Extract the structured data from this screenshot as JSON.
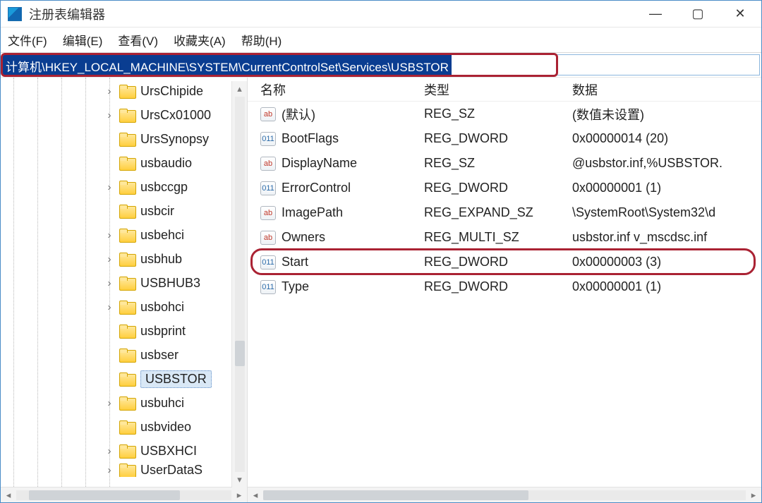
{
  "title": "注册表编辑器",
  "window_controls": {
    "min": "—",
    "max": "▢",
    "close": "✕"
  },
  "menu": {
    "file": "文件(F)",
    "edit": "编辑(E)",
    "view": "查看(V)",
    "favorites": "收藏夹(A)",
    "help": "帮助(H)"
  },
  "address_path": "计算机\\HKEY_LOCAL_MACHINE\\SYSTEM\\CurrentControlSet\\Services\\USBSTOR",
  "tree": {
    "items": [
      {
        "label": "UrsChipide",
        "expand": ">",
        "scroll_hint": "^"
      },
      {
        "label": "UrsCx01000",
        "expand": ">"
      },
      {
        "label": "UrsSynopsy"
      },
      {
        "label": "usbaudio"
      },
      {
        "label": "usbccgp",
        "expand": ">"
      },
      {
        "label": "usbcir"
      },
      {
        "label": "usbehci",
        "expand": ">"
      },
      {
        "label": "usbhub",
        "expand": ">"
      },
      {
        "label": "USBHUB3",
        "expand": ">"
      },
      {
        "label": "usbohci",
        "expand": ">"
      },
      {
        "label": "usbprint"
      },
      {
        "label": "usbser"
      },
      {
        "label": "USBSTOR",
        "selected": true
      },
      {
        "label": "usbuhci",
        "expand": ">"
      },
      {
        "label": "usbvideo"
      },
      {
        "label": "USBXHCI",
        "expand": ">"
      },
      {
        "label": "UserDataS",
        "expand": ">",
        "cutoff": true
      }
    ]
  },
  "list": {
    "headers": {
      "name": "名称",
      "type": "类型",
      "data": "数据"
    },
    "rows": [
      {
        "icon": "str",
        "name": "(默认)",
        "type": "REG_SZ",
        "data": "(数值未设置)"
      },
      {
        "icon": "bin",
        "name": "BootFlags",
        "type": "REG_DWORD",
        "data": "0x00000014 (20)"
      },
      {
        "icon": "str",
        "name": "DisplayName",
        "type": "REG_SZ",
        "data": "@usbstor.inf,%USBSTOR."
      },
      {
        "icon": "bin",
        "name": "ErrorControl",
        "type": "REG_DWORD",
        "data": "0x00000001 (1)"
      },
      {
        "icon": "str",
        "name": "ImagePath",
        "type": "REG_EXPAND_SZ",
        "data": "\\SystemRoot\\System32\\d"
      },
      {
        "icon": "str",
        "name": "Owners",
        "type": "REG_MULTI_SZ",
        "data": "usbstor.inf v_mscdsc.inf"
      },
      {
        "icon": "bin",
        "name": "Start",
        "type": "REG_DWORD",
        "data": "0x00000003 (3)",
        "highlight": true
      },
      {
        "icon": "bin",
        "name": "Type",
        "type": "REG_DWORD",
        "data": "0x00000001 (1)"
      }
    ]
  },
  "icon_text": {
    "str": "ab",
    "bin": "011"
  }
}
